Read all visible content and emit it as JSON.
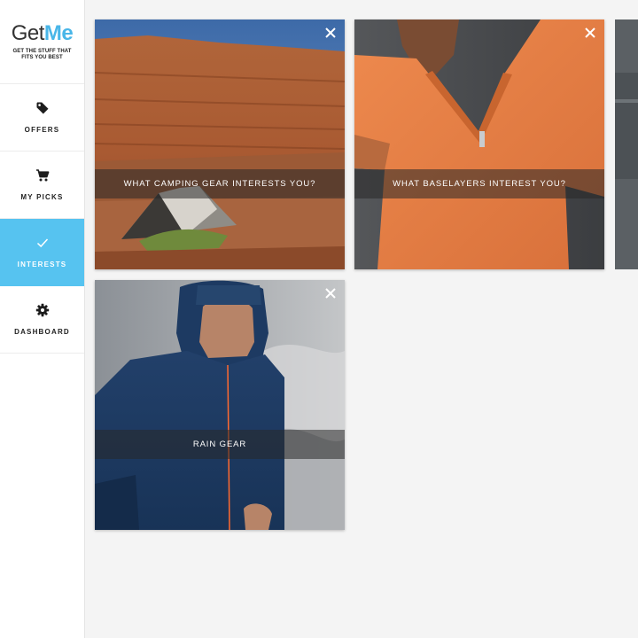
{
  "brand": {
    "get": "Get",
    "me": "Me",
    "tagline_line1": "GET THE STUFF THAT",
    "tagline_line2": "FITS YOU BEST"
  },
  "nav": [
    {
      "label": "OFFERS",
      "icon": "tag-icon"
    },
    {
      "label": "MY PICKS",
      "icon": "cart-icon"
    },
    {
      "label": "INTERESTS",
      "icon": "check-icon",
      "active": true
    },
    {
      "label": "DASHBOARD",
      "icon": "gear-icon"
    }
  ],
  "cards": [
    {
      "title": "WHAT CAMPING GEAR INTERESTS YOU?"
    },
    {
      "title": "WHAT BASELAYERS INTEREST YOU?"
    },
    {
      "title": ""
    },
    {
      "title": "RAIN GEAR"
    }
  ],
  "colors": {
    "accent": "#56c3f0",
    "brand_blue": "#49b6e8",
    "background": "#f4f4f4"
  }
}
